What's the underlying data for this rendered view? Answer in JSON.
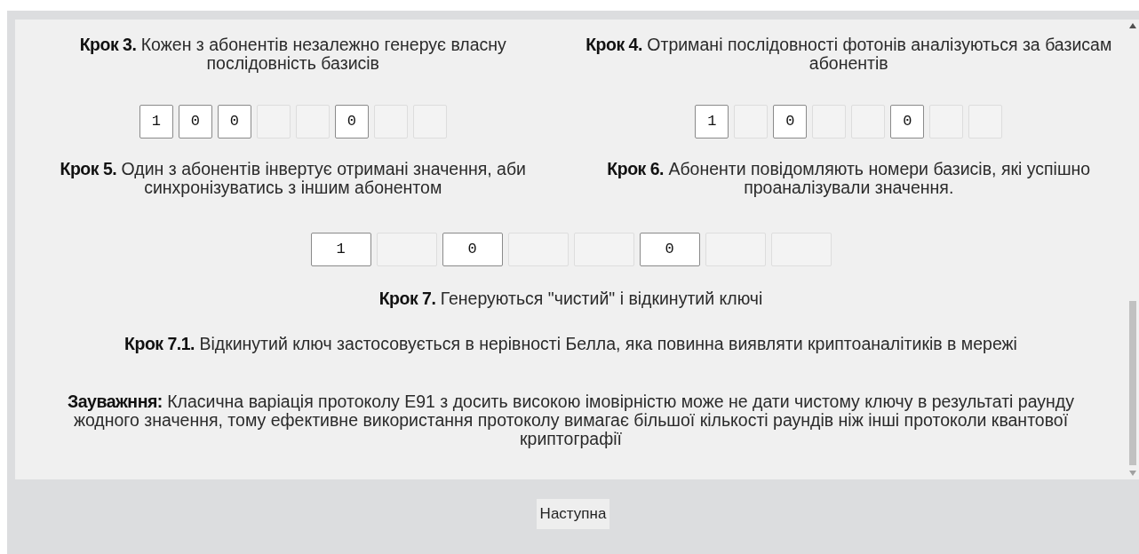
{
  "row_1": [
    {
      "text": "**Крок 3.** Кожен з абонентів незалежно генерує власну послідовність базисів",
      "cells": [
        {
          "filled": true,
          "bit": "1"
        },
        {
          "filled": true,
          "bit": "0"
        },
        {
          "filled": true,
          "bit": "0"
        },
        {
          "filled": false
        },
        {
          "filled": false
        },
        {
          "filled": true,
          "bit": "0"
        },
        {
          "filled": false
        },
        {
          "filled": false
        }
      ]
    },
    {
      "text": "**Крок 4.** Отримані послідовності фотонів аналізуються за базисам абонентів",
      "cells": [
        {
          "filled": true,
          "bit": "1"
        },
        {
          "filled": false
        },
        {
          "filled": true,
          "bit": "0"
        },
        {
          "filled": false
        },
        {
          "filled": false
        },
        {
          "filled": true,
          "bit": "0"
        },
        {
          "filled": false
        },
        {
          "filled": false
        }
      ]
    }
  ],
  "row_2": [
    {
      "text": "**Крок 5.** Один з абонентів інвертує отримані значення, аби синхронізуватись з іншим абонентом"
    },
    {
      "text": "**Крок 6.** Абоненти повідомляють номери базисів, які успішно проаналізували значення."
    }
  ],
  "joint_cells": [
    {
      "filled": true,
      "bit": "1"
    },
    {
      "filled": false
    },
    {
      "filled": true,
      "bit": "0"
    },
    {
      "filled": false
    },
    {
      "filled": false
    },
    {
      "filled": true,
      "bit": "0"
    },
    {
      "filled": false
    },
    {
      "filled": false
    }
  ],
  "steps": [
    "**Крок 7.** Генеруються \"чистий\" і відкинутий ключі",
    "**Крок 7.1.** Відкинутий ключ застосовується в нерівності Белла, яка повинна виявляти криптоаналітиків в мережі"
  ],
  "note": "**Зауважння:** Класична варіація протоколу E91 з досить високою імовірністю може не дати чистому ключу в результаті раунду жодного значення, тому ефективне використання протоколу вимагає більшої кількості раундів ніж інші протоколи квантової криптографії",
  "next_button": "Наступна"
}
